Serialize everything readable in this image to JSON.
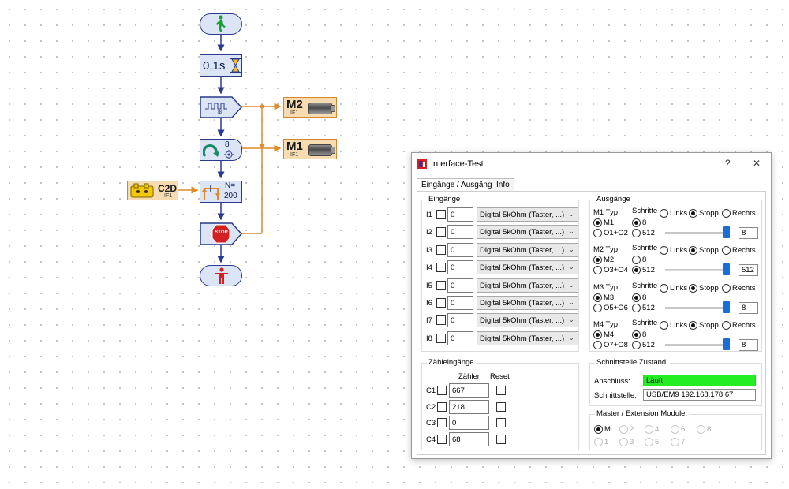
{
  "flowchart": {
    "wait_label": "0,1s",
    "loop_count": "8",
    "counter_label": "N=",
    "counter_value": "200",
    "stop_label": "STOP",
    "pulse_sub": "I8",
    "motor_m2": {
      "label": "M2",
      "sub": "IF1"
    },
    "motor_m1": {
      "label": "M1",
      "sub": "IF1"
    },
    "counter_input": {
      "label": "C2D",
      "sub": "IF1"
    },
    "colors": {
      "block_fill": "#dbe5f5",
      "block_border": "#2a3a8c",
      "flow_orange": "#e08a2c",
      "start_green": "#1a9e3a",
      "stop_red": "#d42020"
    }
  },
  "dialog": {
    "title": "Interface-Test",
    "help": "?",
    "close": "✕",
    "tabs": [
      {
        "label": "Eingänge / Ausgänge"
      },
      {
        "label": "Info"
      }
    ],
    "inputs": {
      "title": "Eingänge",
      "rows": [
        {
          "label": "I1",
          "value": "0",
          "mode": "Digital 5kOhm (Taster, ...)"
        },
        {
          "label": "I2",
          "value": "0",
          "mode": "Digital 5kOhm (Taster, ...)"
        },
        {
          "label": "I3",
          "value": "0",
          "mode": "Digital 5kOhm (Taster, ...)"
        },
        {
          "label": "I4",
          "value": "0",
          "mode": "Digital 5kOhm (Taster, ...)"
        },
        {
          "label": "I5",
          "value": "0",
          "mode": "Digital 5kOhm (Taster, ...)"
        },
        {
          "label": "I6",
          "value": "0",
          "mode": "Digital 5kOhm (Taster, ...)"
        },
        {
          "label": "I7",
          "value": "0",
          "mode": "Digital 5kOhm (Taster, ...)"
        },
        {
          "label": "I8",
          "value": "0",
          "mode": "Digital 5kOhm (Taster, ...)"
        }
      ]
    },
    "counters": {
      "title": "Zähleingänge",
      "col_counter": "Zähler",
      "col_reset": "Reset",
      "rows": [
        {
          "label": "C1",
          "value": "667"
        },
        {
          "label": "C2",
          "value": "218"
        },
        {
          "label": "C3",
          "value": "0"
        },
        {
          "label": "C4",
          "value": "68"
        }
      ]
    },
    "outputs": {
      "title": "Ausgänge",
      "type_suffix": "Typ",
      "steps_label": "Schritte",
      "dir_left": "Links",
      "dir_stop": "Stopp",
      "dir_right": "Rechts",
      "step_low": "8",
      "step_high": "512",
      "motors": [
        {
          "name": "M1",
          "alt": "O1+O2",
          "steps_selected": "8",
          "speed": "8"
        },
        {
          "name": "M2",
          "alt": "O3+O4",
          "steps_selected": "512",
          "speed": "512"
        },
        {
          "name": "M3",
          "alt": "O5+O6",
          "steps_selected": "8",
          "speed": "8"
        },
        {
          "name": "M4",
          "alt": "O7+O8",
          "steps_selected": "8",
          "speed": "8"
        }
      ]
    },
    "status": {
      "title": "Schnittstelle Zustand:",
      "connection_label": "Anschluss:",
      "connection_value": "Läuft",
      "connection_color": "#22ee22",
      "interface_label": "Schnittstelle:",
      "interface_value": "USB/EM9 192.168.178.67"
    },
    "modules": {
      "title": "Master / Extension Module:",
      "options": [
        "M",
        "1",
        "2",
        "3",
        "4",
        "5",
        "6",
        "7",
        "8"
      ],
      "selected": "M"
    }
  }
}
